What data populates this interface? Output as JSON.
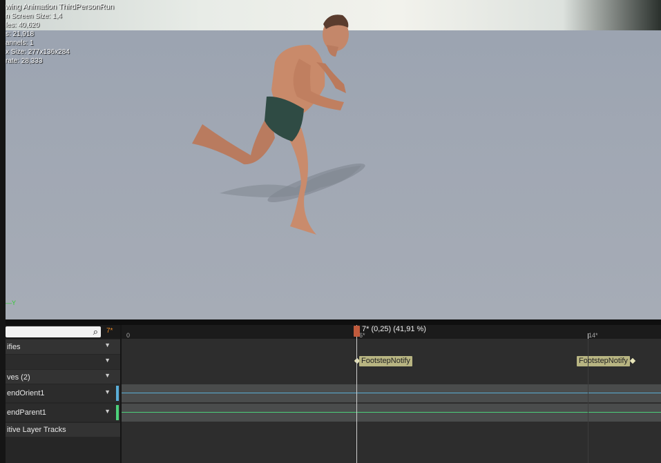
{
  "viewport": {
    "overlay": {
      "title": "wing Animation ThirdPersonRun",
      "lines": [
        "n Screen Size: 1,4",
        "les: 40,620",
        "s: 21,918",
        "annels: 1",
        "x Size: 277x136x284",
        "rate: 28,333"
      ]
    },
    "axis_label": "—Y"
  },
  "track_panel": {
    "frame_badge": "7*",
    "rows": [
      {
        "label": "ifies"
      },
      {
        "label": ""
      },
      {
        "label": "ves  (2)"
      },
      {
        "label": "endOrient1",
        "color": "#5aaed8"
      },
      {
        "label": "endParent1",
        "color": "#4cd27a"
      },
      {
        "label": "itive Layer Tracks"
      }
    ]
  },
  "timeline": {
    "ruler_start": "0",
    "ruler_mid": "6*",
    "ruler_end": "14*",
    "scrubber_label": "7* (0,25) (41,91 %)",
    "notifies": [
      "FootstepNotify",
      "FootstepNotify"
    ],
    "curve_colors": [
      "#5aaed8",
      "#4cd27a"
    ]
  }
}
